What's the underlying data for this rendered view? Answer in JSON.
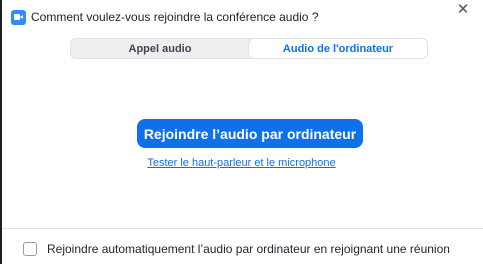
{
  "window": {
    "title": "Comment voulez-vous rejoindre la conférence audio ?",
    "app_icon": "zoom-camera-icon",
    "close_glyph": "✕"
  },
  "tabs": [
    {
      "label": "Appel audio",
      "active": false
    },
    {
      "label": "Audio de l'ordinateur",
      "active": true
    }
  ],
  "main": {
    "join_button_label": "Rejoindre l’audio par ordinateur",
    "test_link_label": "Tester le haut-parleur et le microphone"
  },
  "footer": {
    "auto_join_label": "Rejoindre automatiquement l’audio par ordinateur en rejoignant une réunion",
    "auto_join_checked": false
  },
  "colors": {
    "accent": "#0e71eb",
    "app_icon": "#2d8cff",
    "tab_background": "#eeeef1"
  }
}
